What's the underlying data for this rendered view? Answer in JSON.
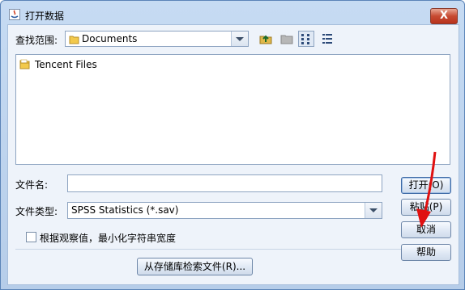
{
  "window": {
    "title": "打开数据",
    "close_label": "X"
  },
  "lookin": {
    "label": "查找范围:",
    "value": "Documents"
  },
  "toolbar": {
    "icons": [
      "up-folder-icon",
      "new-folder-icon",
      "list-view-icon",
      "details-view-icon"
    ]
  },
  "files": [
    {
      "name": "Tencent Files",
      "icon": "folder-icon"
    }
  ],
  "filename": {
    "label": "文件名:",
    "value": ""
  },
  "filetype": {
    "label": "文件类型:",
    "value": "SPSS Statistics (*.sav)"
  },
  "option": {
    "label": "根据观察值，最小化字符串宽度",
    "checked": false
  },
  "buttons": {
    "open": "打开(O)",
    "paste": "粘贴(P)",
    "cancel": "取消",
    "help": "帮助",
    "repository": "从存储库检索文件(R)..."
  },
  "colors": {
    "title_bar": "#c6dbf3",
    "close": "#c74a31",
    "annotation_arrow": "#e01010"
  }
}
